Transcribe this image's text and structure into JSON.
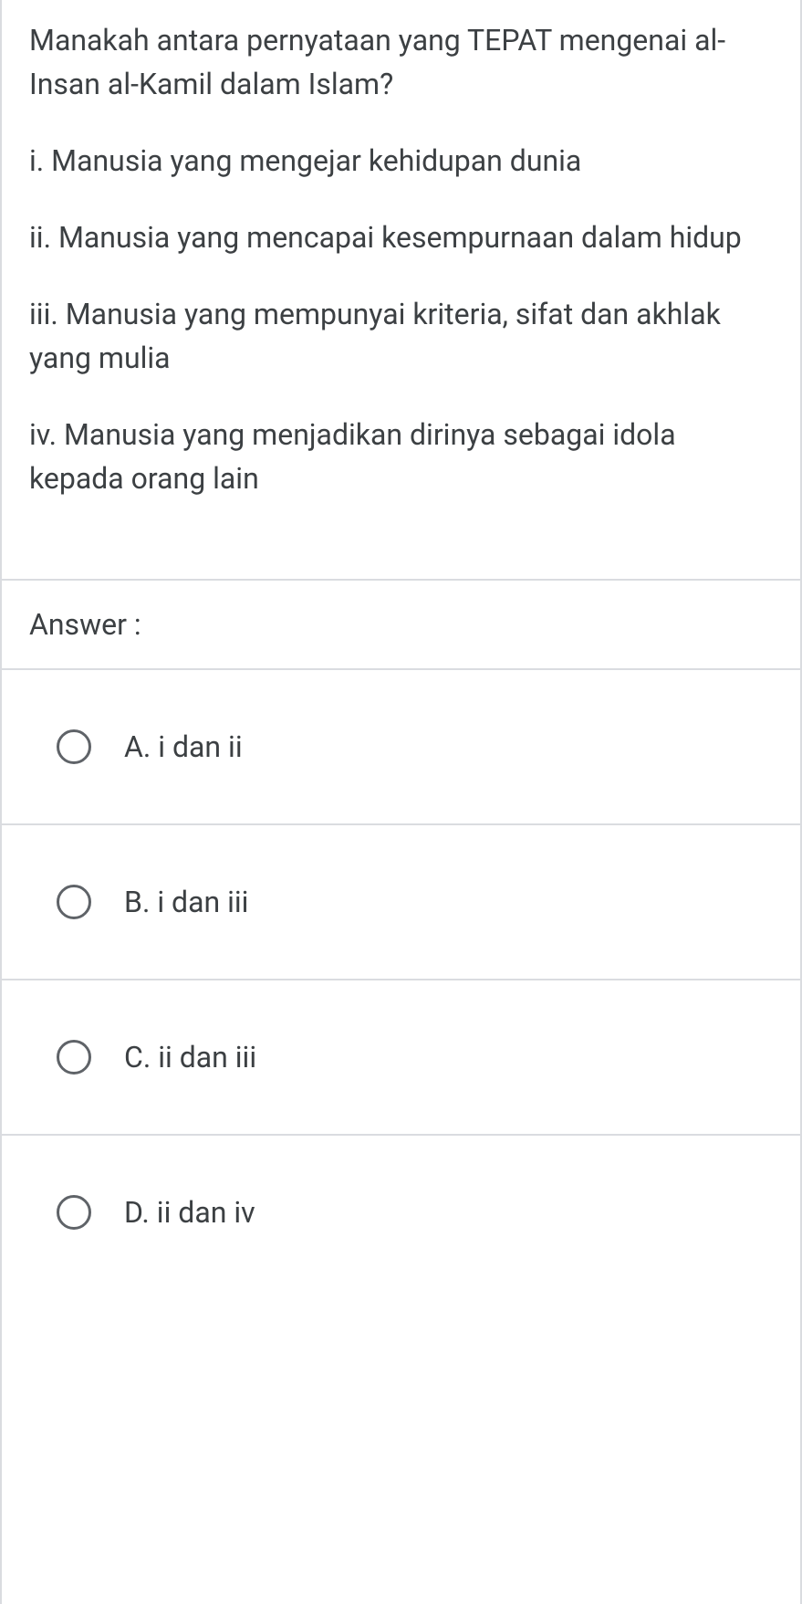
{
  "question": {
    "prompt": "Manakah antara pernyataan yang TEPAT mengenai al-Insan al-Kamil dalam Islam?",
    "statements": [
      "i. Manusia yang mengejar kehidupan dunia",
      "ii. Manusia yang mencapai kesempurnaan dalam hidup",
      "iii. Manusia yang mempunyai kriteria, sifat dan akhlak yang mulia",
      "iv. Manusia yang menjadikan dirinya sebagai idola kepada orang lain"
    ]
  },
  "answer_label": "Answer :",
  "options": [
    {
      "label": "A. i dan ii"
    },
    {
      "label": "B. i dan iii"
    },
    {
      "label": "C. ii dan iii"
    },
    {
      "label": "D. ii dan iv"
    }
  ]
}
